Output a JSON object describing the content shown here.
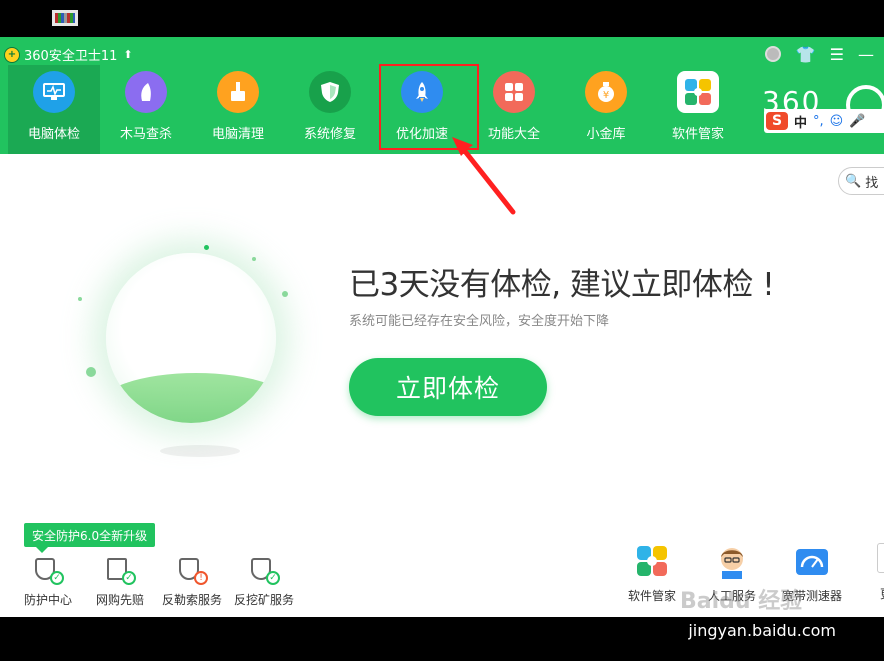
{
  "app": {
    "title": "360安全卫士11",
    "accent": "#21c35f",
    "accent_dark": "#1ba953",
    "highlight_color": "#ff2020"
  },
  "nav": [
    {
      "label": "电脑体检",
      "icon": "monitor-icon",
      "color": "#1fa1e8",
      "active": true
    },
    {
      "label": "木马查杀",
      "icon": "horse-icon",
      "color": "#8b6df0",
      "active": false
    },
    {
      "label": "电脑清理",
      "icon": "broom-icon",
      "color": "#ffa21f",
      "active": false
    },
    {
      "label": "系统修复",
      "icon": "shield-icon",
      "color": "#18a14b",
      "active": false
    },
    {
      "label": "优化加速",
      "icon": "rocket-icon",
      "color": "#2f8cf0",
      "active": false
    },
    {
      "label": "功能大全",
      "icon": "grid-icon",
      "color": "#f26a5a",
      "active": false
    },
    {
      "label": "小金库",
      "icon": "money-bag-icon",
      "color": "#ffa21f",
      "active": false
    },
    {
      "label": "软件管家",
      "icon": "flower-icon",
      "color": "#29b56a",
      "active": false
    }
  ],
  "brand": {
    "text": "360",
    "sogou_letter": "S",
    "sogou_mode": "中"
  },
  "search": {
    "label": "找"
  },
  "main": {
    "headline": "已3天没有体检, 建议立即体检 !",
    "subline": "系统可能已经存在安全风险，安全度开始下降",
    "scan_button": "立即体检"
  },
  "protection": {
    "badge": "安全防护6.0全新升级",
    "items": [
      {
        "label": "防护中心",
        "status": "ok"
      },
      {
        "label": "网购先赔",
        "status": "ok"
      },
      {
        "label": "反勒索服务",
        "status": "warn"
      },
      {
        "label": "反挖矿服务",
        "status": "ok"
      }
    ]
  },
  "tools": [
    {
      "label": "软件管家",
      "icon": "flower-icon"
    },
    {
      "label": "人工服务",
      "icon": "agent-icon"
    },
    {
      "label": "宽带测速器",
      "icon": "speedometer-icon"
    },
    {
      "label": "更多",
      "icon": "plus-icon"
    }
  ],
  "watermark": {
    "text": "Baidu 经验",
    "url": "jingyan.baidu.com"
  }
}
